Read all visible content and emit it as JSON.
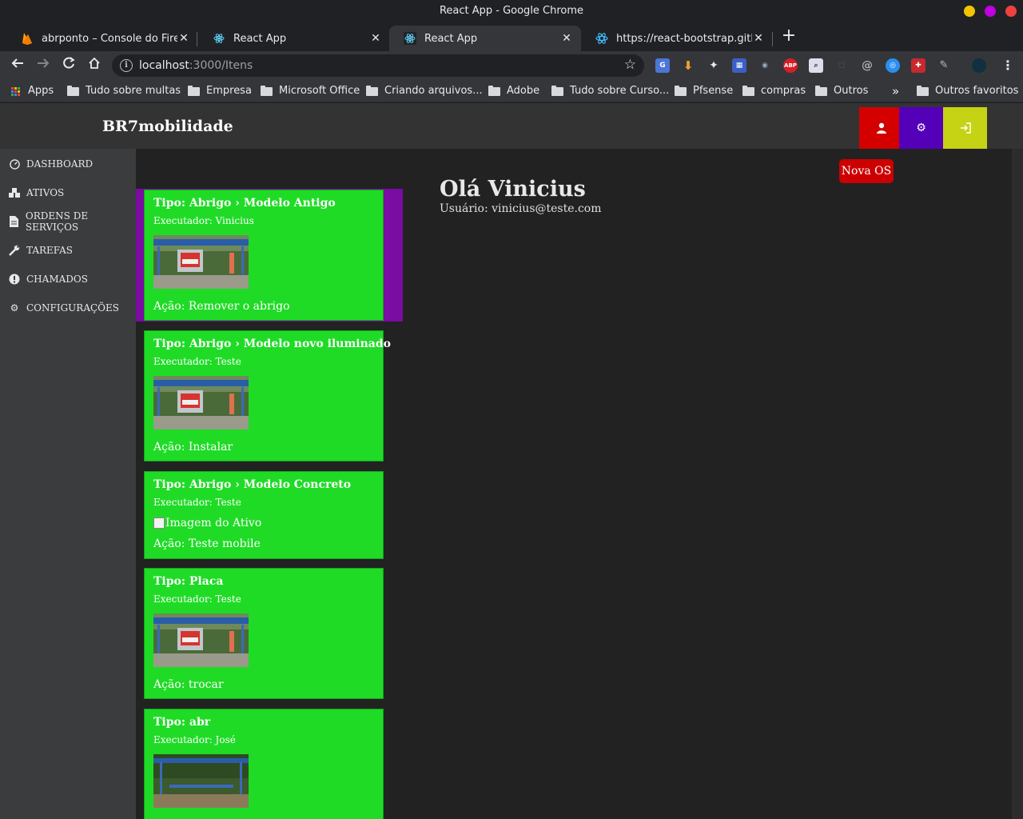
{
  "window": {
    "title": "React App - Google Chrome",
    "controls": [
      "#f5c400",
      "#c000e0",
      "#f04040"
    ]
  },
  "tabs": [
    {
      "title": "abrponto – Console do Firebase",
      "favicon": "firebase-icon"
    },
    {
      "title": "React App",
      "favicon": "react-icon"
    },
    {
      "title": "React App",
      "favicon": "react-icon",
      "active": true
    },
    {
      "title": "https://react-bootstrap.github.io",
      "favicon": "react-bootstrap-icon"
    }
  ],
  "toolbar": {
    "url_host": "localhost",
    "url_path": ":3000/Itens"
  },
  "bookmarks": {
    "apps": "Apps",
    "items": [
      "Tudo sobre multas",
      "Empresa",
      "Microsoft Office",
      "Criando arquivos...",
      "Adobe",
      "Tudo sobre Curso...",
      "Pfsense",
      "compras",
      "Outros"
    ],
    "more": "»",
    "other": "Outros favoritos"
  },
  "app": {
    "brand": "BR7mobilidade",
    "header_buttons": [
      {
        "name": "user-button",
        "icon": "user-icon",
        "color": "#d40000"
      },
      {
        "name": "settings-button",
        "icon": "gear-icon",
        "color": "#5300b8"
      },
      {
        "name": "logout-button",
        "icon": "sign-out-icon",
        "color": "#c6d214"
      }
    ]
  },
  "sidebar": {
    "items": [
      {
        "label": "DASHBOARD",
        "icon": "tachometer-icon"
      },
      {
        "label": "ATIVOS",
        "icon": "cubes-icon"
      },
      {
        "label": "ORDENS DE SERVIÇOS",
        "icon": "file-icon"
      },
      {
        "label": "TAREFAS",
        "icon": "wrench-icon"
      },
      {
        "label": "CHAMADOS",
        "icon": "exclamation-circle-icon"
      },
      {
        "label": "CONFIGURAÇÕES",
        "icon": "gear-icon"
      }
    ]
  },
  "main": {
    "new_os_button": "Nova OS",
    "greeting": "Olá Vinicius",
    "user_line": "Usuário: vinicius@teste.com"
  },
  "cards": [
    {
      "type": "Tipo: Abrigo › Modelo Antigo",
      "executor": "Executador: Vinicius",
      "image": "bus-shelter-photo",
      "action": "Ação: Remover o abrigo",
      "selected": true
    },
    {
      "type": "Tipo: Abrigo › Modelo novo iluminado",
      "executor": "Executador: Teste",
      "image": "bus-shelter-photo",
      "action": "Ação: Instalar"
    },
    {
      "type": "Tipo: Abrigo › Modelo Concreto",
      "executor": "Executador: Teste",
      "image_alt": "Imagem do Ativo",
      "action": "Ação: Teste mobile"
    },
    {
      "type": "Tipo: Placa",
      "executor": "Executador: Teste",
      "image": "bus-shelter-photo",
      "action": "Ação: trocar"
    },
    {
      "type": "Tipo: abr",
      "executor": "Executador: José",
      "image": "bus-shelter-park-photo"
    }
  ],
  "colors": {
    "card_bg": "#1fdb26",
    "selected_card_bg": "#7a0ba3",
    "nova_os": "#cc0000"
  }
}
